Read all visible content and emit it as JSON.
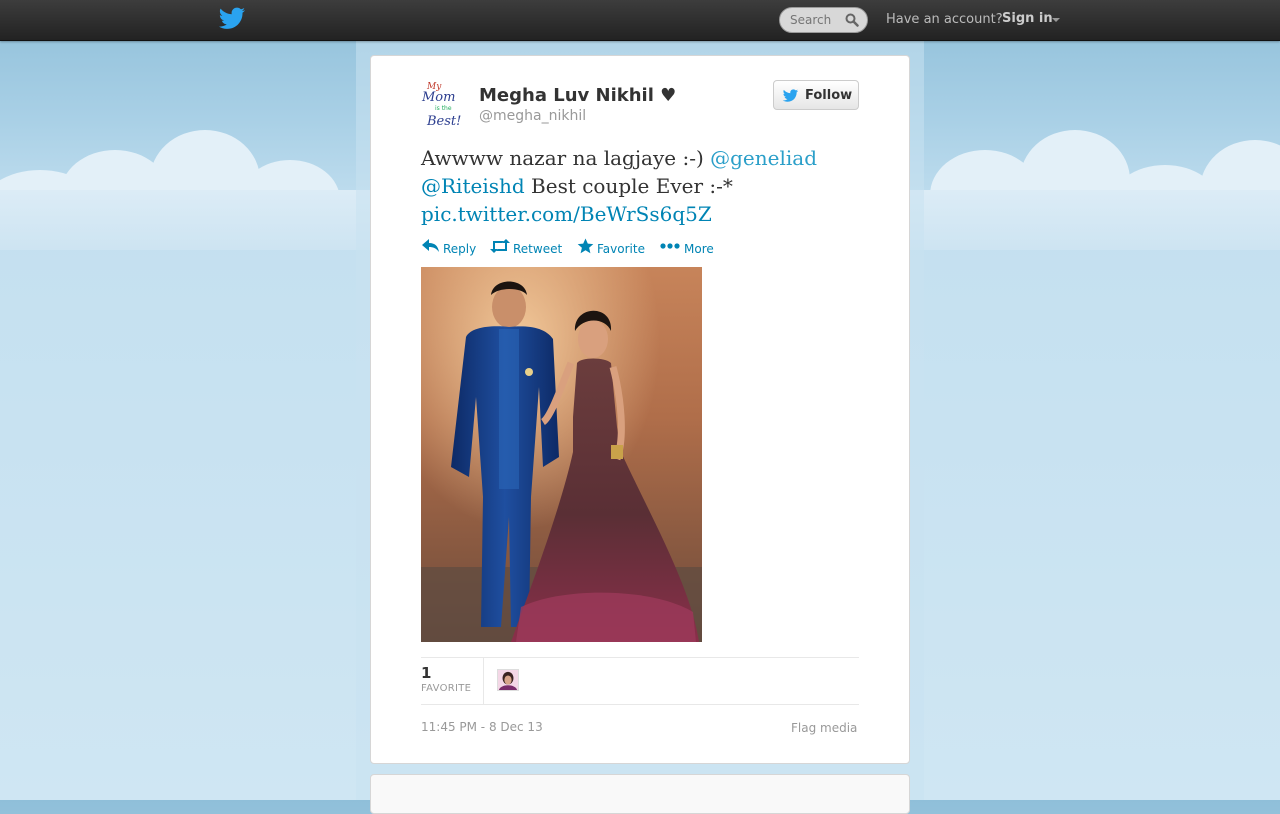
{
  "topbar": {
    "logo_icon": "twitter-bird-icon",
    "search_placeholder": "Search",
    "account_prompt": "Have an account?",
    "signin_label": "Sign in"
  },
  "profile": {
    "name": "Megha Luv Nikhil ♥",
    "handle": "@megha_nikhil",
    "avatar_text": [
      "My",
      "Mom",
      "is the",
      "Best!"
    ],
    "follow_label": "Follow"
  },
  "tweet": {
    "text_1": "Awwww nazar na lagjaye :-) ",
    "mention_1": "@geneliad",
    "mention_2": "@Riteishd",
    "text_2": " Best couple Ever :-*",
    "link": "pic.twitter.com/BeWrSs6q5Z"
  },
  "actions": {
    "reply": "Reply",
    "retweet": "Retweet",
    "favorite": "Favorite",
    "more": "More"
  },
  "stats": {
    "favorite_count": "1",
    "favorite_label": "FAVORITE"
  },
  "footer": {
    "timestamp": "11:45 PM - 8 Dec 13",
    "flag_label": "Flag media"
  },
  "colors": {
    "link": "#0084b4",
    "topbar": "#2b2b2b",
    "background": "#c0dff0"
  }
}
